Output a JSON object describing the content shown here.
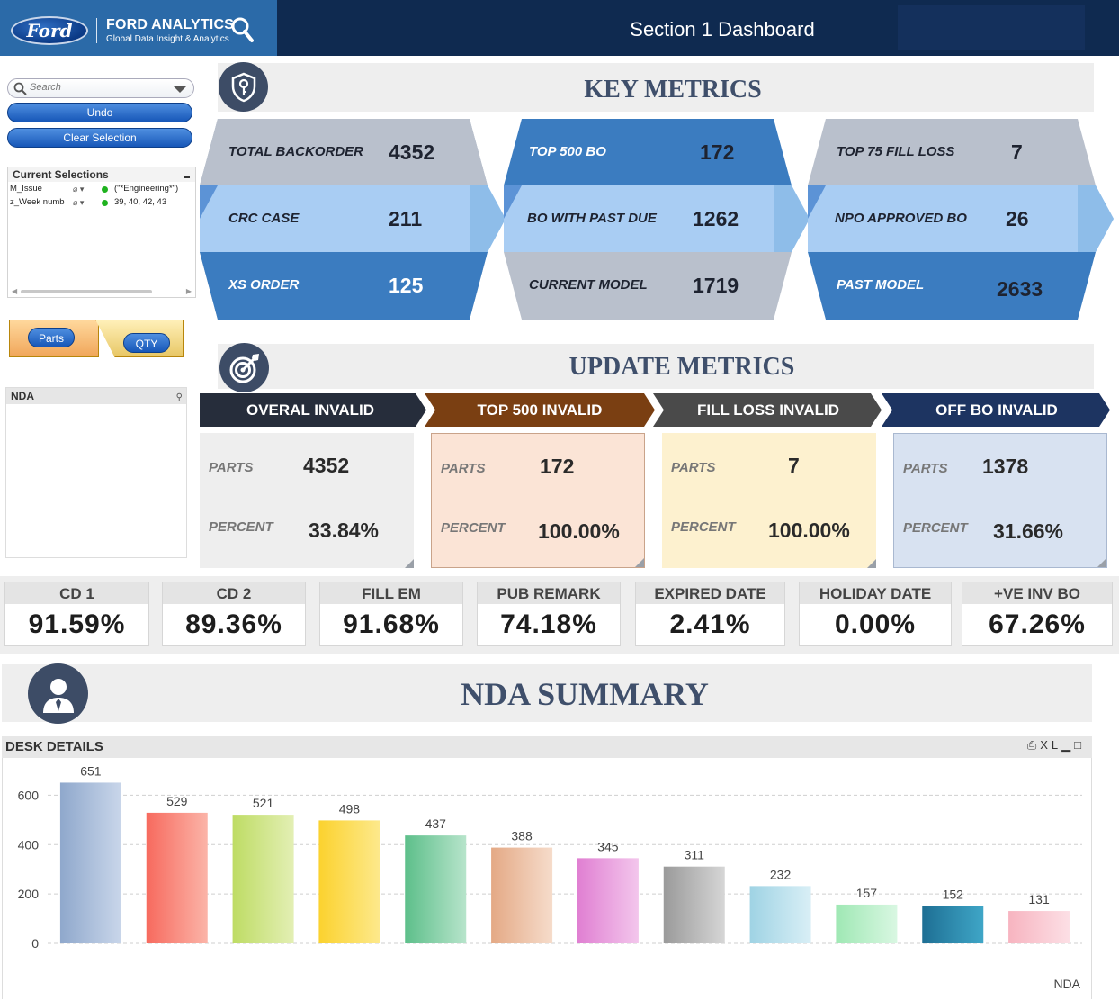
{
  "header": {
    "brand_logo": "Ford",
    "brand_name_bold": "FORD ANALYTICS",
    "brand_sub": "Global Data Insight & Analytics",
    "title": "Section 1 Dashboard",
    "icon": "magnifier-icon",
    "colors": {
      "bar": "#0f2a50",
      "brand": "#2b6aa8"
    }
  },
  "sidebar": {
    "search_placeholder": "Search",
    "undo_label": "Undo",
    "clear_label": "Clear Selection",
    "current_selections": {
      "title": "Current Selections",
      "rows": [
        {
          "field": "M_Issue",
          "value": "(\"*Engineering*\")"
        },
        {
          "field": "z_Week numb",
          "value": "39, 40, 42, 43"
        }
      ]
    },
    "toggle": {
      "parts_label": "Parts",
      "qty_label": "QTY"
    },
    "nda_list_title": "NDA"
  },
  "key_metrics": {
    "title": "KEY METRICS",
    "icon": "shield-key-icon",
    "columns": [
      [
        {
          "label": "TOTAL BACKORDER",
          "value": "4352"
        },
        {
          "label": "CRC CASE",
          "value": "211"
        },
        {
          "label": "XS ORDER",
          "value": "125"
        }
      ],
      [
        {
          "label": "TOP 500 BO",
          "value": "172"
        },
        {
          "label": "BO WITH PAST DUE",
          "value": "1262"
        },
        {
          "label": "CURRENT MODEL",
          "value": "1719"
        }
      ],
      [
        {
          "label": "TOP 75 FILL LOSS",
          "value": "7"
        },
        {
          "label": "NPO APPROVED BO",
          "value": "26"
        },
        {
          "label": "PAST MODEL",
          "value": "2633"
        }
      ]
    ]
  },
  "update_metrics": {
    "title": "UPDATE METRICS",
    "icon": "target-icon",
    "parts_label": "PARTS",
    "percent_label": "PERCENT",
    "cards": [
      {
        "head": "OVERAL INVALID",
        "parts": "4352",
        "percent": "33.84%",
        "head_color": "#262d3b",
        "card_color": "#eeeeee"
      },
      {
        "head": "TOP 500 INVALID",
        "parts": "172",
        "percent": "100.00%",
        "head_color": "#7a3f12",
        "card_color": "#fbe4d6"
      },
      {
        "head": "FILL LOSS INVALID",
        "parts": "7",
        "percent": "100.00%",
        "head_color": "#4a4a4a",
        "card_color": "#fdf1cf"
      },
      {
        "head": "OFF BO INVALID",
        "parts": "1378",
        "percent": "31.66%",
        "head_color": "#1d3461",
        "card_color": "#d8e2f1"
      }
    ]
  },
  "kpis": [
    {
      "label": "CD 1",
      "value": "91.59%"
    },
    {
      "label": "CD 2",
      "value": "89.36%"
    },
    {
      "label": "FILL EM",
      "value": "91.68%"
    },
    {
      "label": "PUB REMARK",
      "value": "74.18%"
    },
    {
      "label": "EXPIRED DATE",
      "value": "2.41%"
    },
    {
      "label": "HOLIDAY DATE",
      "value": "0.00%"
    },
    {
      "label": "+VE INV BO",
      "value": "67.26%"
    }
  ],
  "nda_summary": {
    "title": "NDA SUMMARY",
    "icon": "person-icon",
    "panel_title": "DESK DETAILS",
    "panel_tools": "XL"
  },
  "chart_data": {
    "type": "bar",
    "xlabel": "NDA",
    "ylabel": "",
    "ylim": [
      0,
      700
    ],
    "yticks": [
      0,
      200,
      400,
      600
    ],
    "grid": true,
    "categories": [
      "",
      "",
      "",
      "",
      "",
      "",
      "",
      "",
      "",
      "",
      "",
      ""
    ],
    "values": [
      651,
      529,
      521,
      498,
      437,
      388,
      345,
      311,
      232,
      157,
      152,
      131
    ],
    "colors": [
      [
        "#8fa8cc",
        "#c9d6ea"
      ],
      [
        "#f76a5e",
        "#fbb4a8"
      ],
      [
        "#bedc64",
        "#e3efb4"
      ],
      [
        "#fbd22e",
        "#fde98c"
      ],
      [
        "#5dbf8a",
        "#b7e4cb"
      ],
      [
        "#e4a985",
        "#f6dccb"
      ],
      [
        "#e07fd2",
        "#f3c6ec"
      ],
      [
        "#9a9a9a",
        "#d6d6d6"
      ],
      [
        "#9fd3e4",
        "#d9eff6"
      ],
      [
        "#9fe8b4",
        "#d9f7e2"
      ],
      [
        "#1e6f94",
        "#3fa6c7"
      ],
      [
        "#f7b4c0",
        "#fcdfe5"
      ]
    ]
  }
}
